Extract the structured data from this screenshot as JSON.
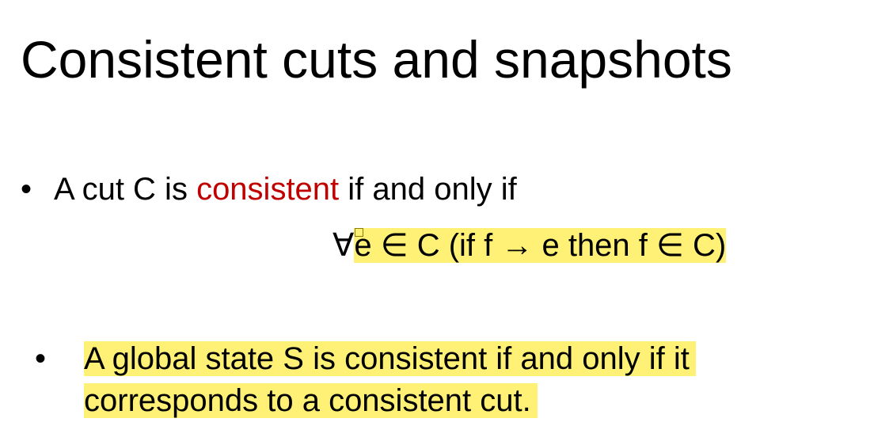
{
  "slide": {
    "title": "Consistent cuts and snapshots",
    "bullets": [
      {
        "marker": "•",
        "prefix": "A cut C is ",
        "highlight_word": "consistent",
        "suffix": " if and only if"
      },
      {
        "marker": "•",
        "text": "A global state S is consistent if and only if it corresponds to a consistent cut."
      }
    ],
    "formula": {
      "quantifier": "∀",
      "body": "e ∈  C (if f → e then f ∈  C)"
    }
  },
  "colors": {
    "accent": "#c00000",
    "highlight": "#fff176"
  }
}
